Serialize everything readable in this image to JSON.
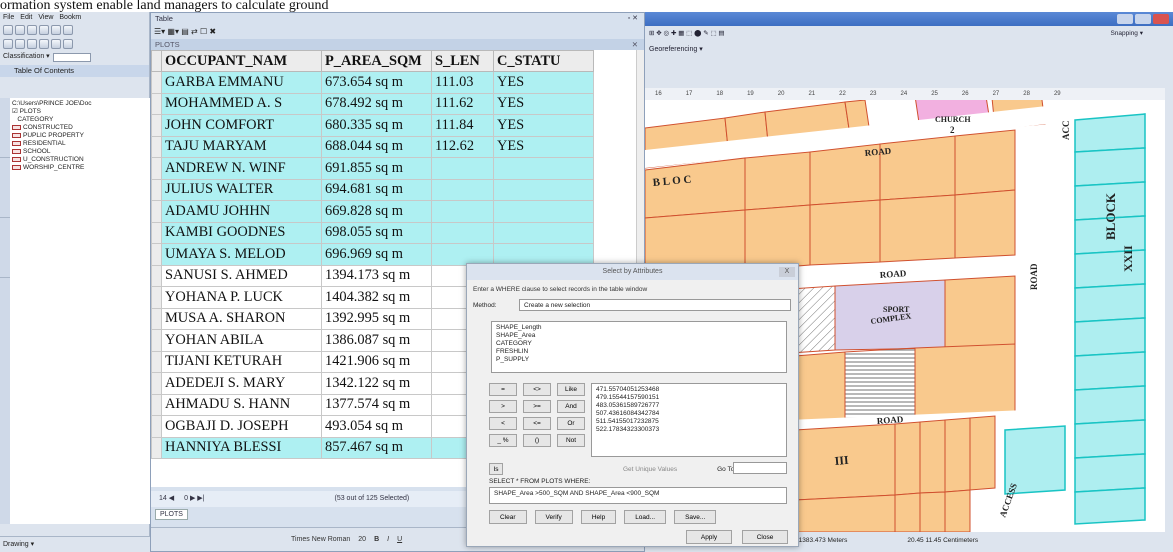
{
  "doc_text": "ormation system enable land managers to calculate ground",
  "arcmap": {
    "menu": [
      "File",
      "Edit",
      "View",
      "Bookm"
    ],
    "classification_label": "Classification ▾",
    "toc_title": "Table Of Contents",
    "toc_path": "C:\\Users\\PRINCE JOE\\Doc",
    "toc_layer": "PLOTS",
    "toc_field": "CATEGORY",
    "toc_items": [
      "CONSTRUCTED",
      "PUPLIC PROPERTY",
      "RESIDENTIAL",
      "SCHOOL",
      "U_CONSTRUCTION",
      "WORSHIP_CENTRE"
    ],
    "drawing_label": "Drawing ▾"
  },
  "table_window": {
    "title": "Table",
    "layer_tab": "PLOTS",
    "columns": [
      "OCCUPANT_NAM",
      "P_AREA_SQM",
      "S_LEN",
      "C_STATU"
    ],
    "rows": [
      {
        "selected": true,
        "name": "GARBA EMMANU",
        "area": "673.654 sq m",
        "len": "111.03",
        "status": "YES"
      },
      {
        "selected": true,
        "name": "MOHAMMED A. S",
        "area": "678.492 sq m",
        "len": "111.62",
        "status": "YES"
      },
      {
        "selected": true,
        "name": "JOHN COMFORT",
        "area": "680.335 sq m",
        "len": "111.84",
        "status": "YES"
      },
      {
        "selected": true,
        "name": "TAJU MARYAM",
        "area": "688.044 sq m",
        "len": "112.62",
        "status": "YES"
      },
      {
        "selected": true,
        "name": " ANDREW N. WINF",
        "area": "691.855 sq m",
        "len": "",
        "status": ""
      },
      {
        "selected": true,
        "name": "JULIUS WALTER",
        "area": "694.681 sq m",
        "len": "",
        "status": ""
      },
      {
        "selected": true,
        "name": "ADAMU JOHHN",
        "area": "669.828 sq m",
        "len": "",
        "status": ""
      },
      {
        "selected": true,
        "name": "KAMBI GOODNES",
        "area": "698.055 sq m",
        "len": "",
        "status": ""
      },
      {
        "selected": true,
        "name": "UMAYA S. MELOD",
        "area": "696.969 sq m",
        "len": "",
        "status": ""
      },
      {
        "selected": false,
        "name": "SANUSI S. AHMED",
        "area": "1394.173 sq m",
        "len": "",
        "status": ""
      },
      {
        "selected": false,
        "name": "YOHANA  P. LUCK",
        "area": "1404.382 sq m",
        "len": "",
        "status": ""
      },
      {
        "selected": false,
        "name": "MUSA  A. SHARON",
        "area": "1392.995 sq m",
        "len": "",
        "status": ""
      },
      {
        "selected": false,
        "name": "YOHAN  ABILA",
        "area": "1386.087 sq m",
        "len": "",
        "status": ""
      },
      {
        "selected": false,
        "name": "TIJANI KETURAH",
        "area": "1421.906 sq m",
        "len": "",
        "status": ""
      },
      {
        "selected": false,
        "name": "ADEDEJI S. MARY",
        "area": "1342.122 sq m",
        "len": "",
        "status": ""
      },
      {
        "selected": false,
        "name": "AHMADU S. HANN",
        "area": "1377.574 sq m",
        "len": "",
        "status": ""
      },
      {
        "selected": false,
        "name": "OGBAJI D. JOSEPH",
        "area": "493.054 sq m",
        "len": "",
        "status": ""
      },
      {
        "selected": true,
        "name": "HANNIYA BLESSI",
        "area": "857.467 sq m",
        "len": "",
        "status": ""
      }
    ],
    "nav_left": "14 ◀",
    "nav_mid": "0 ▶ ▶|",
    "selection_count": "(53 out of 125 Selected)",
    "footer_font": "Times New Roman",
    "footer_size": "20"
  },
  "map_window": {
    "georeferencing": "Georeferencing ▾",
    "snapping": "Snapping ▾",
    "ruler_ticks": [
      "16",
      "17",
      "18",
      "19",
      "20",
      "21",
      "22",
      "23",
      "24",
      "25",
      "26",
      "27",
      "28",
      "29"
    ],
    "status_left": "31383.473 Meters",
    "status_right": "20.45  11.45 Centimeters",
    "labels": {
      "church": "CHURCH",
      "church_num": "2",
      "road": "ROAD",
      "block": "BLOCK",
      "sport_complex_1": "SPORT",
      "sport_complex_2": "COMPLEX",
      "access": "ACCESS",
      "acc": "ACC",
      "block_xxii": "XXII",
      "block_iii": "III",
      "block_letter_b": "B L O C"
    },
    "colors": {
      "plot_fill": "#f9c98d",
      "plot_border": "#d0502f",
      "selected_fill": "#aeeef0",
      "selected_border": "#19c4c4",
      "church_fill": "#f2b0e0",
      "sport_fill": "#d8d0ea"
    }
  },
  "dialog": {
    "title": "Select by Attributes",
    "close": "X",
    "hint": "Enter a WHERE clause to select records in the table window",
    "method_label": "Method:",
    "method_value": "Create a new selection",
    "fields": [
      "SHAPE_Length",
      "SHAPE_Area",
      "CATEGORY",
      "FRESHLIN",
      "P_SUPPLY"
    ],
    "operators": [
      "=",
      "<>",
      "Like",
      ">",
      ">=",
      "And",
      "<",
      "<=",
      "Or",
      "_ %",
      "()",
      "Not"
    ],
    "is_label": "Is",
    "values": [
      "471.55704051253468",
      "479.15544157590151",
      "483.05361589726777",
      "507.43616084342784",
      "511.54155017232875",
      "522.17834323300373"
    ],
    "get_unique": "Get Unique Values",
    "go_to": "Go To:",
    "sql_label": "SELECT * FROM PLOTS WHERE:",
    "sql": "SHAPE_Area >500_SQM AND SHAPE_Area <900_SQM",
    "buttons": [
      "Clear",
      "Verify",
      "Help",
      "Load...",
      "Save..."
    ],
    "apply": "Apply",
    "close_btn": "Close"
  }
}
